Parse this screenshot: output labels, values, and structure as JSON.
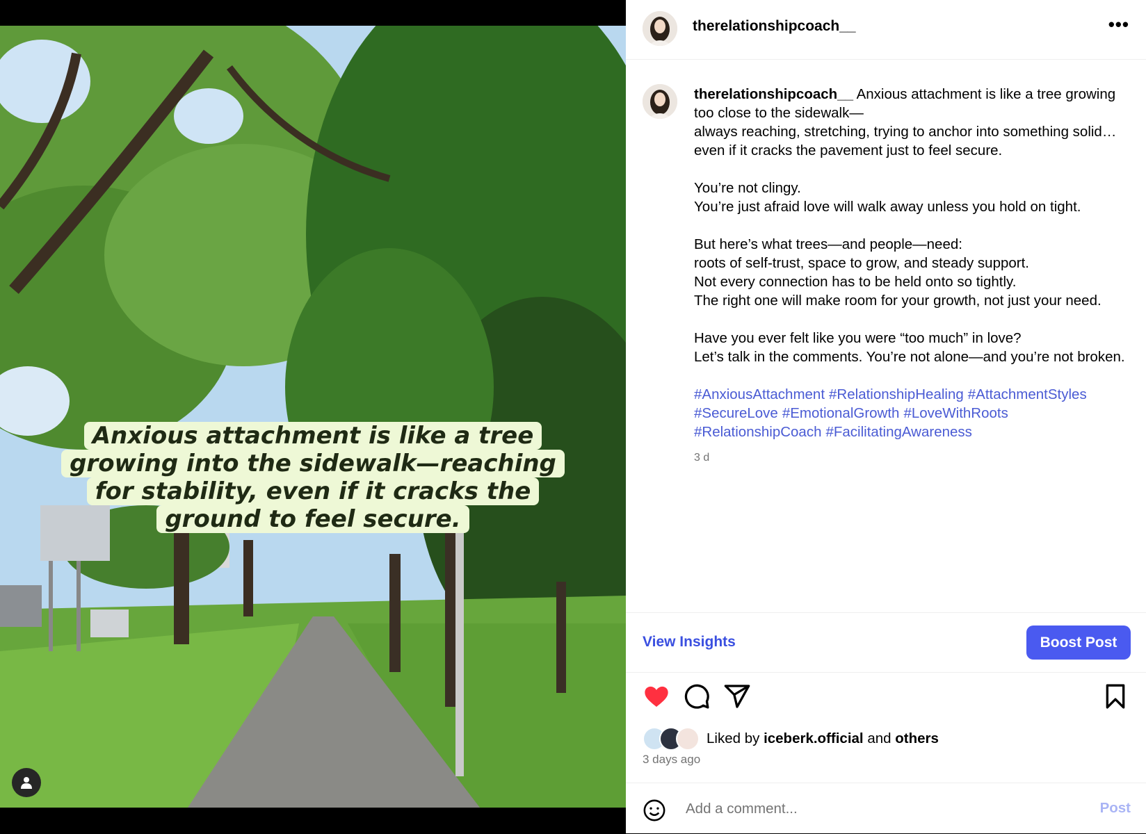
{
  "header": {
    "username": "therelationshipcoach__",
    "more_icon": "more-horizontal-icon"
  },
  "media": {
    "overlay_lines": [
      "Anxious attachment is like a tree",
      "growing into the sidewalk—reaching",
      "for stability, even if it cracks the",
      "ground to feel secure."
    ],
    "tag_icon": "user-tag-icon"
  },
  "caption": {
    "username": "therelationshipcoach__",
    "lines": [
      "Anxious attachment is like a tree growing too close to the sidewalk—",
      "always reaching, stretching, trying to anchor into something solid…",
      "even if it cracks the pavement just to feel secure.",
      "",
      "You’re not clingy.",
      "You’re just afraid love will walk away unless you hold on tight.",
      "",
      "But here’s what trees—and people—need:",
      "roots of self-trust, space to grow, and steady support.",
      "Not every connection has to be held onto so tightly.",
      "The right one will make room for your growth, not just your need.",
      "",
      "Have you ever felt like you were “too much” in love?",
      "Let’s talk in the comments. You’re not alone—and you’re not broken."
    ],
    "hashtags": [
      "#AnxiousAttachment",
      "#RelationshipHealing",
      "#AttachmentStyles",
      "#SecureLove",
      "#EmotionalGrowth",
      "#LoveWithRoots",
      "#RelationshipCoach",
      "#FacilitatingAwareness"
    ],
    "age": "3 d"
  },
  "insights": {
    "view_label": "View Insights",
    "boost_label": "Boost Post"
  },
  "actions": {
    "like_icon": "heart-filled-icon",
    "comment_icon": "comment-icon",
    "share_icon": "share-icon",
    "save_icon": "bookmark-icon",
    "like_color": "#ff3040"
  },
  "likes": {
    "prefix": "Liked by",
    "user": "iceberk.official",
    "middle": "and",
    "others": "others",
    "time": "3 days ago"
  },
  "comment": {
    "placeholder": "Add a comment...",
    "post_label": "Post",
    "emoji_icon": "emoji-icon"
  },
  "colors": {
    "link_blue": "#4a5bd4",
    "boost_bg": "#4a5af0",
    "overlay_bg": "#eef8d6"
  }
}
